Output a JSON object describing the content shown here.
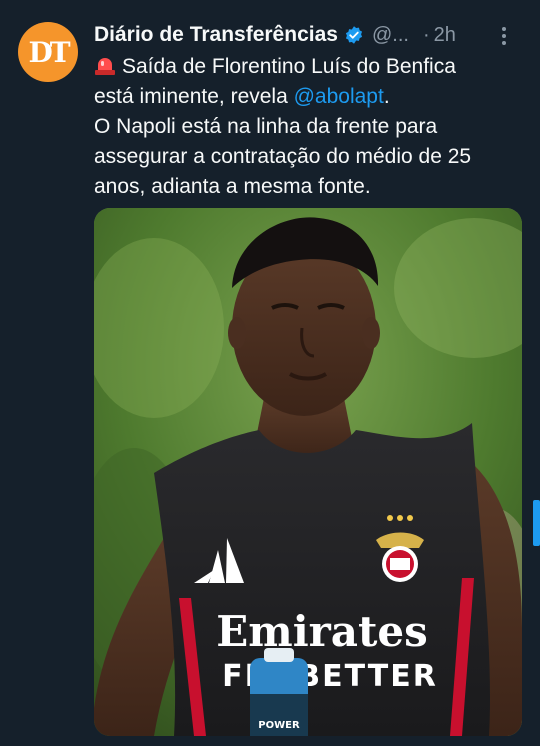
{
  "tweet": {
    "display_name": "Diário de Transferências",
    "handle": "@...",
    "separator": "·",
    "time": "2h",
    "avatar_initials": "DT",
    "lines": [
      "Saída de Florentino Luís do Benfica",
      "está iminente, revela ",
      "O Napoli está na linha da frente para",
      "assegurar a contratação do médio de 25",
      "anos, adianta a mesma fonte."
    ],
    "mention": "@abolapt",
    "mention_trailing": ".",
    "media": {
      "shirt_sponsor_line1": "Emirates",
      "shirt_sponsor_line2": "FLY BETTER",
      "bottle_label": "POWER"
    }
  },
  "colors": {
    "background": "#15202b",
    "accent": "#1d9bf0",
    "avatar": "#f5952b",
    "secondary_text": "#8b98a5"
  },
  "icons": {
    "verified": "verified-badge-icon",
    "more": "more-options-icon",
    "siren": "police-siren-emoji"
  }
}
